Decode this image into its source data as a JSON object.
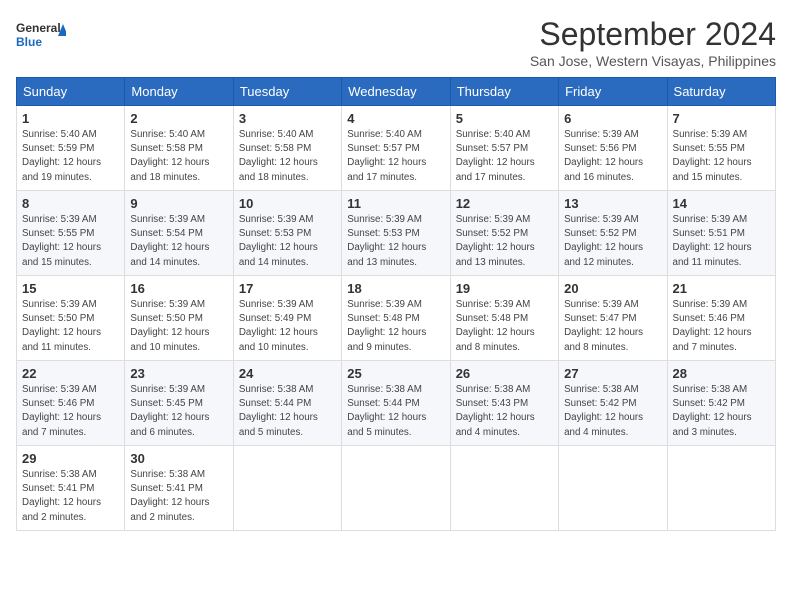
{
  "header": {
    "logo_line1": "General",
    "logo_line2": "Blue",
    "month": "September 2024",
    "location": "San Jose, Western Visayas, Philippines"
  },
  "weekdays": [
    "Sunday",
    "Monday",
    "Tuesday",
    "Wednesday",
    "Thursday",
    "Friday",
    "Saturday"
  ],
  "weeks": [
    [
      {
        "day": "1",
        "sunrise": "5:40 AM",
        "sunset": "5:59 PM",
        "daylight": "12 hours and 19 minutes."
      },
      {
        "day": "2",
        "sunrise": "5:40 AM",
        "sunset": "5:58 PM",
        "daylight": "12 hours and 18 minutes."
      },
      {
        "day": "3",
        "sunrise": "5:40 AM",
        "sunset": "5:58 PM",
        "daylight": "12 hours and 18 minutes."
      },
      {
        "day": "4",
        "sunrise": "5:40 AM",
        "sunset": "5:57 PM",
        "daylight": "12 hours and 17 minutes."
      },
      {
        "day": "5",
        "sunrise": "5:40 AM",
        "sunset": "5:57 PM",
        "daylight": "12 hours and 17 minutes."
      },
      {
        "day": "6",
        "sunrise": "5:39 AM",
        "sunset": "5:56 PM",
        "daylight": "12 hours and 16 minutes."
      },
      {
        "day": "7",
        "sunrise": "5:39 AM",
        "sunset": "5:55 PM",
        "daylight": "12 hours and 15 minutes."
      }
    ],
    [
      {
        "day": "8",
        "sunrise": "5:39 AM",
        "sunset": "5:55 PM",
        "daylight": "12 hours and 15 minutes."
      },
      {
        "day": "9",
        "sunrise": "5:39 AM",
        "sunset": "5:54 PM",
        "daylight": "12 hours and 14 minutes."
      },
      {
        "day": "10",
        "sunrise": "5:39 AM",
        "sunset": "5:53 PM",
        "daylight": "12 hours and 14 minutes."
      },
      {
        "day": "11",
        "sunrise": "5:39 AM",
        "sunset": "5:53 PM",
        "daylight": "12 hours and 13 minutes."
      },
      {
        "day": "12",
        "sunrise": "5:39 AM",
        "sunset": "5:52 PM",
        "daylight": "12 hours and 13 minutes."
      },
      {
        "day": "13",
        "sunrise": "5:39 AM",
        "sunset": "5:52 PM",
        "daylight": "12 hours and 12 minutes."
      },
      {
        "day": "14",
        "sunrise": "5:39 AM",
        "sunset": "5:51 PM",
        "daylight": "12 hours and 11 minutes."
      }
    ],
    [
      {
        "day": "15",
        "sunrise": "5:39 AM",
        "sunset": "5:50 PM",
        "daylight": "12 hours and 11 minutes."
      },
      {
        "day": "16",
        "sunrise": "5:39 AM",
        "sunset": "5:50 PM",
        "daylight": "12 hours and 10 minutes."
      },
      {
        "day": "17",
        "sunrise": "5:39 AM",
        "sunset": "5:49 PM",
        "daylight": "12 hours and 10 minutes."
      },
      {
        "day": "18",
        "sunrise": "5:39 AM",
        "sunset": "5:48 PM",
        "daylight": "12 hours and 9 minutes."
      },
      {
        "day": "19",
        "sunrise": "5:39 AM",
        "sunset": "5:48 PM",
        "daylight": "12 hours and 8 minutes."
      },
      {
        "day": "20",
        "sunrise": "5:39 AM",
        "sunset": "5:47 PM",
        "daylight": "12 hours and 8 minutes."
      },
      {
        "day": "21",
        "sunrise": "5:39 AM",
        "sunset": "5:46 PM",
        "daylight": "12 hours and 7 minutes."
      }
    ],
    [
      {
        "day": "22",
        "sunrise": "5:39 AM",
        "sunset": "5:46 PM",
        "daylight": "12 hours and 7 minutes."
      },
      {
        "day": "23",
        "sunrise": "5:39 AM",
        "sunset": "5:45 PM",
        "daylight": "12 hours and 6 minutes."
      },
      {
        "day": "24",
        "sunrise": "5:38 AM",
        "sunset": "5:44 PM",
        "daylight": "12 hours and 5 minutes."
      },
      {
        "day": "25",
        "sunrise": "5:38 AM",
        "sunset": "5:44 PM",
        "daylight": "12 hours and 5 minutes."
      },
      {
        "day": "26",
        "sunrise": "5:38 AM",
        "sunset": "5:43 PM",
        "daylight": "12 hours and 4 minutes."
      },
      {
        "day": "27",
        "sunrise": "5:38 AM",
        "sunset": "5:42 PM",
        "daylight": "12 hours and 4 minutes."
      },
      {
        "day": "28",
        "sunrise": "5:38 AM",
        "sunset": "5:42 PM",
        "daylight": "12 hours and 3 minutes."
      }
    ],
    [
      {
        "day": "29",
        "sunrise": "5:38 AM",
        "sunset": "5:41 PM",
        "daylight": "12 hours and 2 minutes."
      },
      {
        "day": "30",
        "sunrise": "5:38 AM",
        "sunset": "5:41 PM",
        "daylight": "12 hours and 2 minutes."
      },
      null,
      null,
      null,
      null,
      null
    ]
  ]
}
